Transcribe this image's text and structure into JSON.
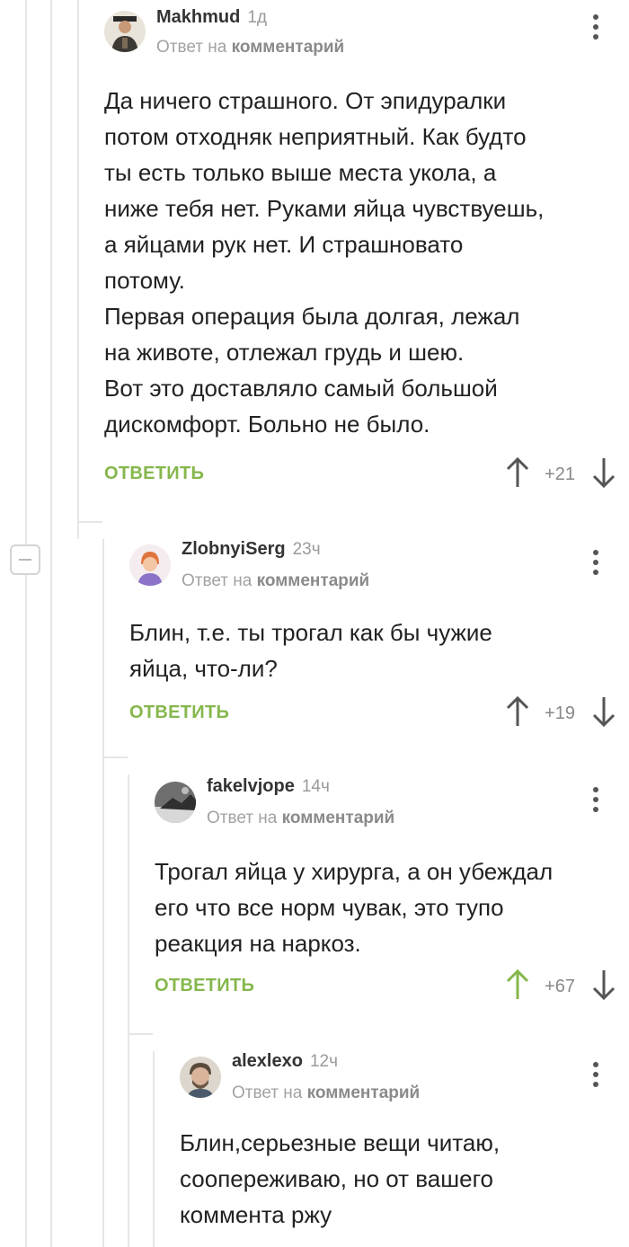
{
  "comments": [
    {
      "author": "Makhmud",
      "time": "1д",
      "reply_prefix": "Ответ на",
      "reply_target": "комментарий",
      "text": "Да ничего страшного. От эпидуралки\nпотом отходняк неприятный. Как будто\nты есть только выше места укола, а\nниже тебя нет. Руками яйца чувствуешь,\nа яйцами рук нет. И страшновато\nпотому.\nПервая операция была долгая, лежал\nна животе, отлежал грудь и шею.\nВот это доставляло самый большой\nдискомфорт. Больно не было.",
      "reply_label": "ОТВЕТИТЬ",
      "score": "+21",
      "upvoted": false
    },
    {
      "author": "ZlobnyiSerg",
      "time": "23ч",
      "reply_prefix": "Ответ на",
      "reply_target": "комментарий",
      "text": "Блин, т.е. ты трогал как бы чужие\nяйца, что-ли?",
      "reply_label": "ОТВЕТИТЬ",
      "score": "+19",
      "upvoted": false
    },
    {
      "author": "fakelvjope",
      "time": "14ч",
      "reply_prefix": "Ответ на",
      "reply_target": "комментарий",
      "text": "Трогал яйца у хирурга, а он убеждал\nего что все норм чувак, это тупо\nреакция на наркоз.",
      "reply_label": "ОТВЕТИТЬ",
      "score": "+67",
      "upvoted": true
    },
    {
      "author": "alexlexo",
      "time": "12ч",
      "reply_prefix": "Ответ на",
      "reply_target": "комментарий",
      "text": "Блин,серьезные вещи читаю,\nсоопереживаю, но от вашего\nкоммента ржу"
    }
  ],
  "colors": {
    "accent_green": "#85b74c",
    "vote_arrow": "#555555",
    "thread_line": "#e6e6e6"
  },
  "icons": [
    "more-vertical-icon",
    "arrow-up-icon",
    "arrow-down-icon",
    "collapse-minus-icon"
  ]
}
